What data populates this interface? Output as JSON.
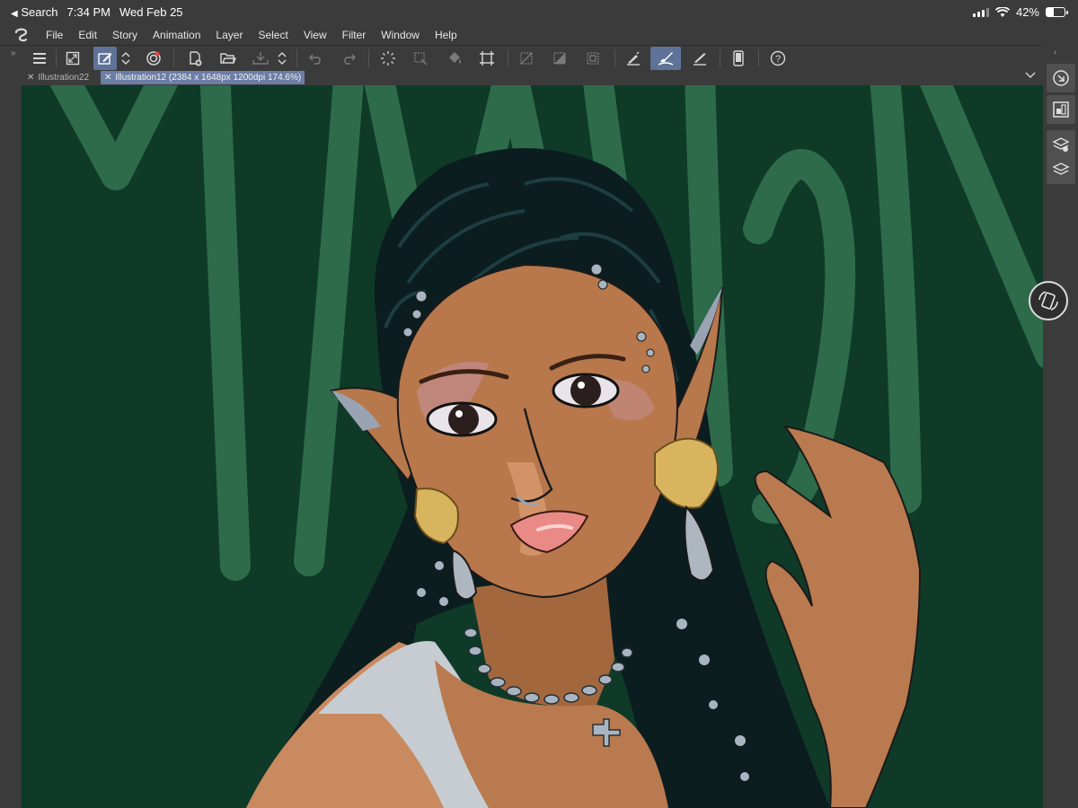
{
  "status_bar": {
    "back_label": "Search",
    "time": "7:34 PM",
    "date": "Wed Feb 25",
    "battery_percent": "42%",
    "battery_level": 0.42
  },
  "menu": {
    "items": [
      "File",
      "Edit",
      "Story",
      "Animation",
      "Layer",
      "Select",
      "View",
      "Filter",
      "Window",
      "Help"
    ]
  },
  "toolbar": {
    "icons": [
      "menu-icon",
      "fullscreen-icon",
      "edit-mode-icon",
      "mode-toggle-icon",
      "canvas-shift-icon",
      "new-file-icon",
      "open-file-icon",
      "save-icon",
      "save-toggle-icon",
      "undo-icon",
      "redo-icon",
      "loading-icon",
      "transform-selection-icon",
      "fill-icon",
      "crop-icon",
      "clear-selection-icon",
      "invert-selection-icon",
      "selection-border-icon",
      "pen-stabilizer-icon",
      "brush-icon",
      "ruler-icon",
      "smartphone-icon",
      "help-icon"
    ]
  },
  "tabs": [
    {
      "title": "Illustration22"
    },
    {
      "title": "Illustration12 (2384 x 1648px 1200dpi 174.6%)"
    }
  ],
  "colors": {
    "ui_background": "#3b3b3b",
    "active_tab": "#6c7ea5",
    "active_tool": "#5f7297",
    "canvas_background": "#0f3a28",
    "canvas_strokes": "#2e6b4b"
  },
  "right_panel": {
    "icons": [
      "navigator-icon",
      "sub-view-icon",
      "layer-properties-icon",
      "layers-icon"
    ]
  },
  "floating": {
    "icon": "rotate-device-icon"
  }
}
